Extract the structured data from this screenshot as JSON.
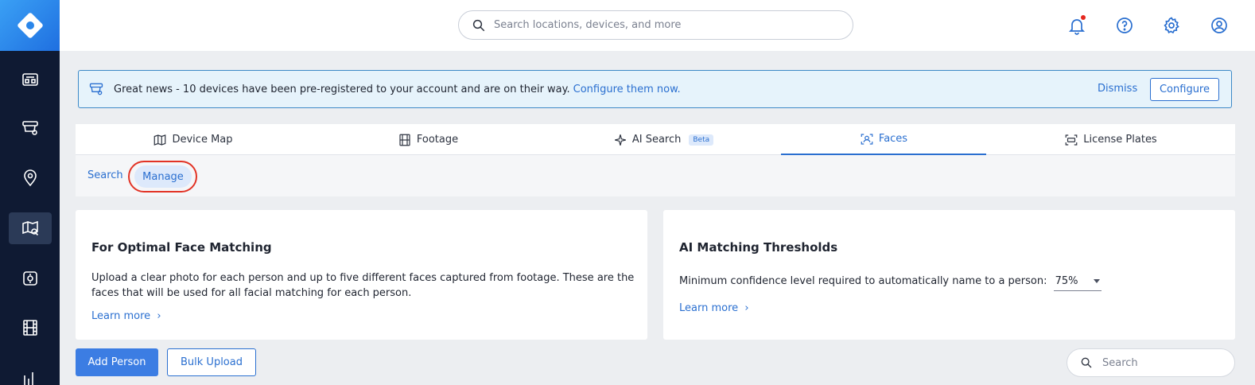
{
  "header": {
    "search_placeholder": "Search locations, devices, and more"
  },
  "banner": {
    "message": "Great news - 10 devices have been pre-registered to your account and are on their way.",
    "link": "Configure them now.",
    "dismiss_label": "Dismiss",
    "configure_label": "Configure"
  },
  "tabs": [
    {
      "label": "Device Map",
      "icon": "map-icon"
    },
    {
      "label": "Footage",
      "icon": "film-icon"
    },
    {
      "label": "AI Search",
      "icon": "sparkle-icon",
      "badge": "Beta"
    },
    {
      "label": "Faces",
      "icon": "face-scan-icon",
      "active": true
    },
    {
      "label": "License Plates",
      "icon": "license-plate-icon"
    }
  ],
  "subnav": {
    "search_label": "Search",
    "manage_label": "Manage"
  },
  "card_left": {
    "title": "For Optimal Face Matching",
    "body_line1": "Upload a clear photo for each person and up to five different faces captured from footage. These are the",
    "body_line2": "faces that will be used for all facial matching for each person.",
    "learn_more": "Learn more"
  },
  "card_right": {
    "title": "AI Matching Thresholds",
    "body": "Minimum confidence level required to automatically name to a person:",
    "threshold_value": "75%",
    "learn_more": "Learn more"
  },
  "actions": {
    "add_person_label": "Add Person",
    "bulk_upload_label": "Bulk Upload",
    "search_placeholder": "Search"
  },
  "colors": {
    "accent": "#2a6fd0",
    "rail_bg": "#0f1a33",
    "highlight_circle": "#e23325"
  }
}
